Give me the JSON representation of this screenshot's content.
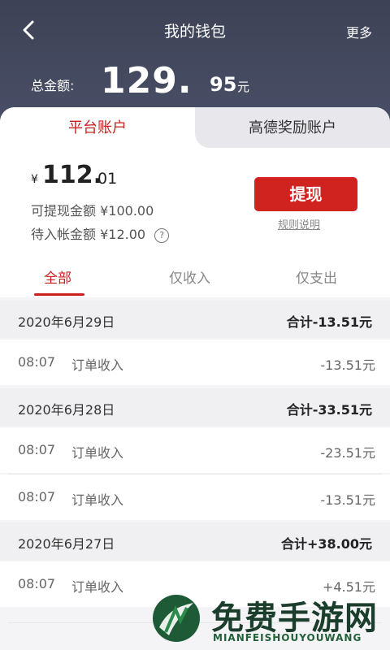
{
  "header": {
    "title": "我的钱包",
    "more_label": "更多",
    "total_label": "总金额:",
    "total_int": "129.",
    "total_dec": "95",
    "total_unit": "元"
  },
  "account_tabs": [
    {
      "label": "平台账户",
      "active": true
    },
    {
      "label": "高德奖励账户",
      "active": false
    }
  ],
  "balance": {
    "currency": "¥",
    "int": "112.",
    "dec": "01",
    "withdrawable_label": "可提现金额",
    "withdrawable_value": "¥100.00",
    "pending_label": "待入帐金额",
    "pending_value": "¥12.00",
    "help_glyph": "?"
  },
  "actions": {
    "withdraw_label": "提现",
    "rules_label": "规则说明"
  },
  "filters": [
    {
      "label": "全部",
      "active": true
    },
    {
      "label": "仅收入",
      "active": false
    },
    {
      "label": "仅支出",
      "active": false
    }
  ],
  "groups": [
    {
      "date": "2020年6月29日",
      "total": "合计-13.51元",
      "items": [
        {
          "time": "08:07",
          "desc": "订单收入",
          "amount": "-13.51元"
        }
      ]
    },
    {
      "date": "2020年6月28日",
      "total": "合计-33.51元",
      "items": [
        {
          "time": "08:07",
          "desc": "订单收入",
          "amount": "-23.51元"
        },
        {
          "time": "08:07",
          "desc": "订单收入",
          "amount": "-13.51元"
        }
      ]
    },
    {
      "date": "2020年6月27日",
      "total": "合计+38.00元",
      "items": [
        {
          "time": "08:07",
          "desc": "订单收入",
          "amount": "+4.51元"
        }
      ]
    }
  ],
  "watermark": {
    "text": "免费手游网",
    "sub": "MIANFEISHOUYOUWANG"
  },
  "colors": {
    "accent": "#c8201e",
    "header_bg": "#424760",
    "button_red": "#d0221f"
  }
}
